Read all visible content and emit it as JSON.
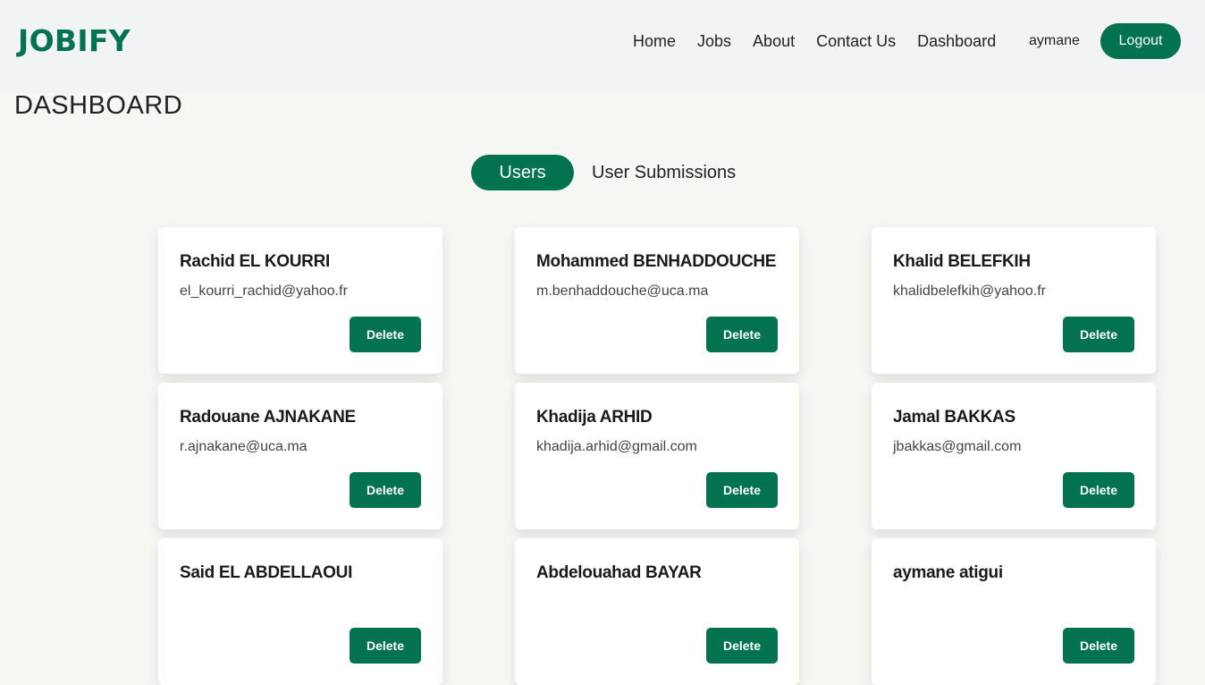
{
  "brand": {
    "logo": "JOBIFY",
    "accent": "#027251"
  },
  "nav": {
    "links": [
      "Home",
      "Jobs",
      "About",
      "Contact Us",
      "Dashboard"
    ],
    "username": "aymane",
    "logout_label": "Logout"
  },
  "page": {
    "title": "DASHBOARD"
  },
  "tabs": {
    "active": "Users",
    "other": "User Submissions"
  },
  "users": [
    {
      "name": "Rachid EL KOURRI",
      "email": "el_kourri_rachid@yahoo.fr",
      "delete_label": "Delete"
    },
    {
      "name": "Mohammed BENHADDOUCHE",
      "email": "m.benhaddouche@uca.ma",
      "delete_label": "Delete"
    },
    {
      "name": "Khalid BELEFKIH",
      "email": "khalidbelefkih@yahoo.fr",
      "delete_label": "Delete"
    },
    {
      "name": "Radouane AJNAKANE",
      "email": "r.ajnakane@uca.ma",
      "delete_label": "Delete"
    },
    {
      "name": "Khadija ARHID",
      "email": "khadija.arhid@gmail.com",
      "delete_label": "Delete"
    },
    {
      "name": "Jamal BAKKAS",
      "email": "jbakkas@gmail.com",
      "delete_label": "Delete"
    },
    {
      "name": "Said EL ABDELLAOUI",
      "email": "",
      "delete_label": "Delete"
    },
    {
      "name": "Abdelouahad BAYAR",
      "email": "",
      "delete_label": "Delete"
    },
    {
      "name": "aymane atigui",
      "email": "",
      "delete_label": "Delete"
    }
  ]
}
